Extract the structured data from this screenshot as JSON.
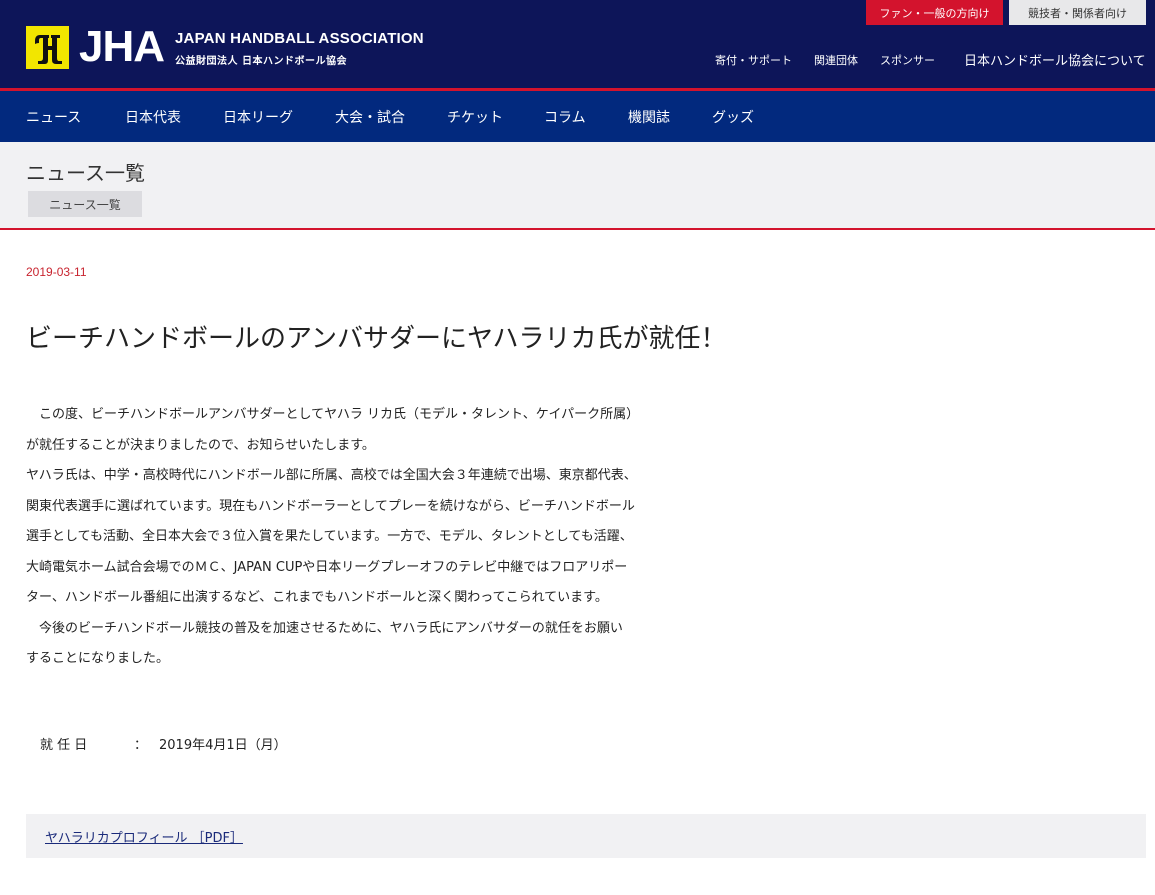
{
  "header": {
    "logo_text": "JHA",
    "org_en": "JAPAN HANDBALL ASSOCIATION",
    "org_jp": "公益財団法人 日本ハンドボール協会",
    "fan_button": "ファン・一般の方向け",
    "player_button": "競技者・関係者向け",
    "util_links": [
      "寄付・サポート",
      "関連団体",
      "スポンサー"
    ],
    "about_link": "日本ハンドボール協会について"
  },
  "nav": {
    "items": [
      "ニュース",
      "日本代表",
      "日本リーグ",
      "大会・試合",
      "チケット",
      "コラム",
      "機関誌",
      "グッズ"
    ]
  },
  "breadcrumb": {
    "title": "ニュース一覧",
    "chip": "ニュース一覧"
  },
  "article": {
    "date": "2019-03-11",
    "title": "ビーチハンドボールのアンバサダーにヤハラリカ氏が就任！",
    "lines": [
      "　この度、ビーチハンドボールアンバサダーとしてヤハラ リカ氏（モデル・タレント、ケイパーク所属）",
      "が就任することが決まりましたので、お知らせいたします。",
      "ヤハラ氏は、中学・高校時代にハンドボール部に所属、高校では全国大会３年連続で出場、東京都代表、",
      "関東代表選手に選ばれています。現在もハンドボーラーとしてプレーを続けながら、ビーチハンドボール",
      "選手としても活動、全日本大会で３位入賞を果たしています。一方で、モデル、タレントとしても活躍、",
      "大崎電気ホーム試合会場でのＭＣ、JAPAN CUPや日本リーグプレーオフのテレビ中継ではフロアリポー",
      "ター、ハンドボール番組に出演するなど、これまでもハンドボールと深く関わってこられています。",
      "　今後のビーチハンドボール競技の普及を加速させるために、ヤハラ氏にアンバサダーの就任をお願い",
      "することになりました。"
    ],
    "meta_label": "就 任 日",
    "meta_sep": "：",
    "meta_value": "2019年4月1日（月）",
    "pdf_link": "ヤハラリカプロフィール ［PDF］"
  },
  "colors": {
    "header_bg": "#0d1559",
    "nav_bg": "#02297e",
    "accent_red": "#d3132d",
    "logo_yellow": "#f2e600"
  }
}
